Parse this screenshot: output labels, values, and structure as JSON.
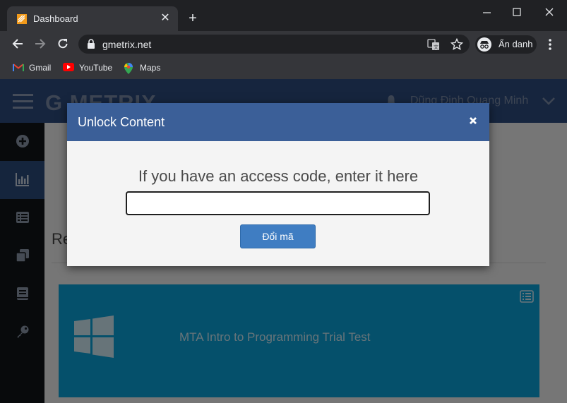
{
  "browser": {
    "tab": {
      "title": "Dashboard",
      "close_glyph": "✕"
    },
    "new_tab_glyph": "+",
    "url": "gmetrix.net",
    "incognito_label": "Ẩn danh",
    "bookmarks": [
      {
        "label": "Gmail",
        "icon": "gmail-icon"
      },
      {
        "label": "YouTube",
        "icon": "youtube-icon"
      },
      {
        "label": "Maps",
        "icon": "maps-icon"
      }
    ]
  },
  "site": {
    "logo_text": "G METRIX",
    "username": "Dũng Đinh Quang Minh",
    "sidebar_icons": [
      "plus-circle-icon",
      "bar-chart-icon",
      "list-icon",
      "copy-icon",
      "book-icon",
      "key-icon"
    ],
    "active_sidebar_index": 1,
    "recent_label": "Re",
    "card": {
      "title": "MTA Intro to Programming Trial Test"
    }
  },
  "modal": {
    "title": "Unlock Content",
    "prompt": "If you have an access code, enter it here",
    "input_value": "",
    "button_label": "Đổi mã"
  },
  "colors": {
    "header_blue": "#2d4a7c",
    "modal_header": "#3b5f98",
    "button_blue": "#3f7dc2",
    "card_blue": "#0aa0d6"
  }
}
